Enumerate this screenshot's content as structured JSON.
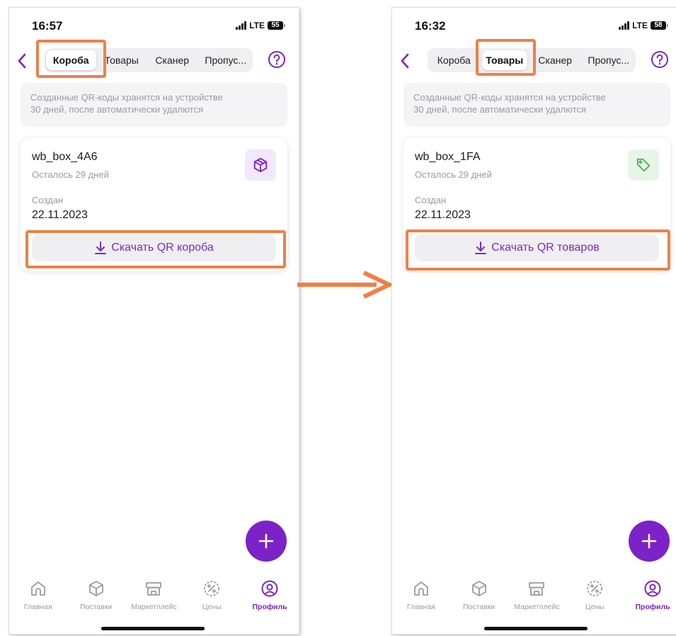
{
  "colors": {
    "accent": "#7c22c8",
    "highlight": "#f07f45",
    "icon_gray": "#9a9aa1",
    "tag_green": "#4caf50"
  },
  "screens": [
    {
      "status": {
        "time": "16:57",
        "network": "LTE",
        "battery": "55"
      },
      "tabs": [
        "Короба",
        "Товары",
        "Сканер",
        "Пропус..."
      ],
      "active_tab": 0,
      "notice": {
        "line1": "Созданные QR-коды хранятся на устройстве",
        "line2": "30 дней, после автоматически удалются"
      },
      "card": {
        "title": "wb_box_4A6",
        "remaining": "Осталось 29 дней",
        "created_label": "Создан",
        "created_value": "22.11.2023",
        "icon": "box-icon",
        "download_label": "Скачать QR короба"
      }
    },
    {
      "status": {
        "time": "16:32",
        "network": "LTE",
        "battery": "58"
      },
      "tabs": [
        "Короба",
        "Товары",
        "Сканер",
        "Пропус..."
      ],
      "active_tab": 1,
      "notice": {
        "line1": "Созданные QR-коды хранятся на устройстве",
        "line2": "30 дней, после автоматически удалются"
      },
      "card": {
        "title": "wb_box_1FA",
        "remaining": "Осталось 29 дней",
        "created_label": "Создан",
        "created_value": "22.11.2023",
        "icon": "tag-icon",
        "download_label": "Скачать QR товаров"
      }
    }
  ],
  "nav": [
    {
      "label": "Главная",
      "icon": "home-icon"
    },
    {
      "label": "Поставки",
      "icon": "box-icon"
    },
    {
      "label": "Маркетплейс",
      "icon": "store-icon"
    },
    {
      "label": "Цены",
      "icon": "percent-icon"
    },
    {
      "label": "Профиль",
      "icon": "profile-icon"
    }
  ],
  "active_nav": 4
}
